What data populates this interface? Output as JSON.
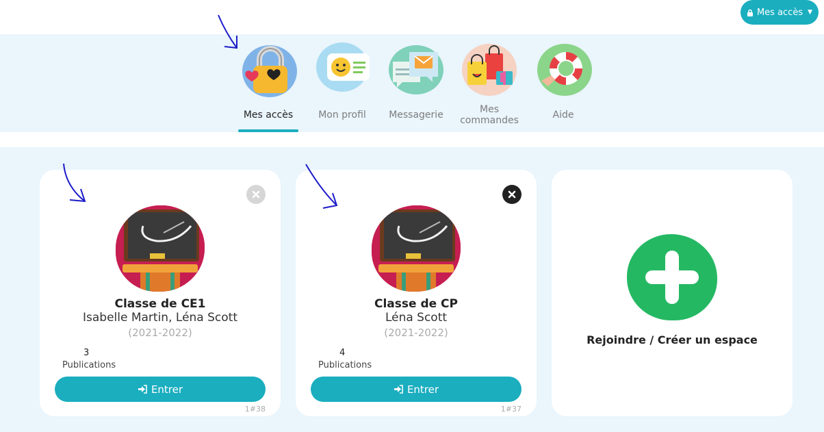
{
  "header": {
    "access_button_label": "Mes accès"
  },
  "nav": {
    "items": [
      {
        "label": "Mes accès",
        "icon": "padlock-hearts-icon",
        "active": true
      },
      {
        "label": "Mon profil",
        "icon": "profile-card-icon"
      },
      {
        "label": "Messagerie",
        "icon": "envelope-chat-icon"
      },
      {
        "label": "Mes commandes",
        "icon": "shopping-bags-icon"
      },
      {
        "label": "Aide",
        "icon": "lifebuoy-icon"
      }
    ]
  },
  "cards": [
    {
      "title": "Classe de CE1",
      "teachers": "Isabelle Martin, Léna Scott",
      "year": "(2021-2022)",
      "publications_count": "3",
      "publications_label": "Publications",
      "enter_label": "Entrer",
      "id": "1#38"
    },
    {
      "title": "Classe de CP",
      "teachers": "Léna Scott",
      "year": "(2021-2022)",
      "publications_count": "4",
      "publications_label": "Publications",
      "enter_label": "Entrer",
      "id": "1#37"
    }
  ],
  "join_card": {
    "label": "Rejoindre / Créer un espace"
  },
  "colors": {
    "accent": "#1aaebf",
    "background": "#eaf5fc",
    "join_green": "#25b863",
    "annotation_arrow": "#1c1cc8"
  }
}
